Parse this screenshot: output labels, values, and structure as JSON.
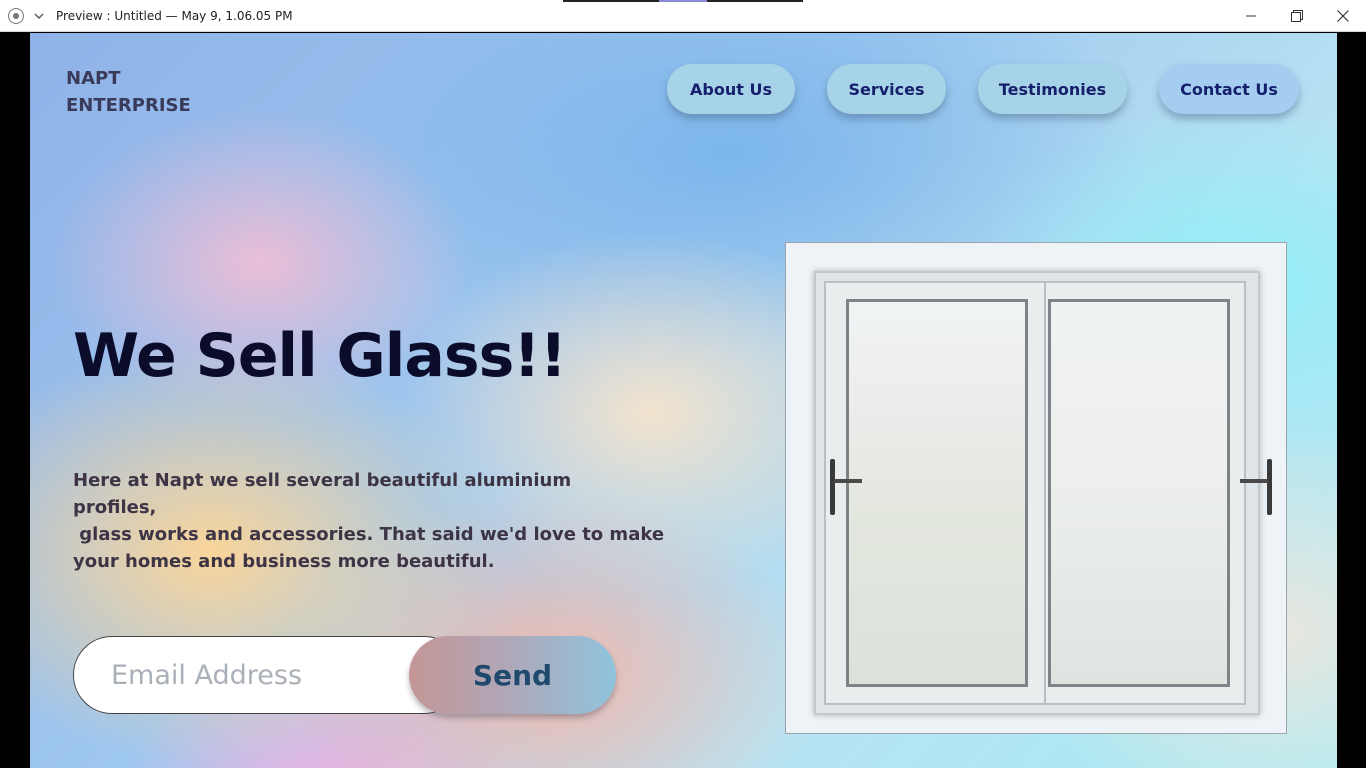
{
  "titlebar": {
    "title": "Preview : Untitled — May 9, 1.06.05 PM",
    "app_icon": "record-icon",
    "menu_icon": "chevron-down-icon",
    "controls": [
      "minimize-icon",
      "restore-icon",
      "close-icon"
    ]
  },
  "brand": {
    "line1": "NAPT",
    "line2": "ENTERPRISE"
  },
  "nav": {
    "items": [
      {
        "label": "About Us"
      },
      {
        "label": "Services"
      },
      {
        "label": "Testimonies"
      },
      {
        "label": "Contact Us"
      }
    ]
  },
  "hero": {
    "title": "We Sell Glass!!",
    "text_line1": "Here at Napt we sell several beautiful aluminium profiles,",
    "text_line2": " glass works and accessories. That said we'd love to make",
    "text_line3": "your homes and business more beautiful."
  },
  "signup": {
    "email_placeholder": "Email Address",
    "email_value": "",
    "send_label": "Send"
  },
  "image": {
    "subject": "sliding-window-image"
  },
  "colors": {
    "nav_text": "#151f6b",
    "nav_bg": "#a7d3e8",
    "title": "#0b0b2a",
    "send_text": "#1f4a6e"
  }
}
